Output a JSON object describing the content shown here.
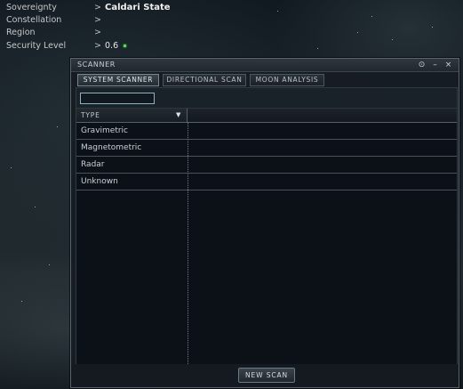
{
  "info": {
    "rows": [
      {
        "label": "Sovereignty",
        "arrow": ">",
        "value": "Caldari State"
      },
      {
        "label": "Constellation",
        "arrow": ">",
        "value": ""
      },
      {
        "label": "Region",
        "arrow": ">",
        "value": ""
      },
      {
        "label": "Security Level",
        "arrow": ">",
        "value": "0.6"
      }
    ],
    "security_color": "#4ddf4d"
  },
  "window": {
    "title": "SCANNER",
    "buttons": {
      "options": "⊙",
      "minimize": "–",
      "close": "×"
    },
    "tabs": [
      {
        "label": "SYSTEM SCANNER",
        "active": true
      },
      {
        "label": "DIRECTIONAL SCAN",
        "active": false
      },
      {
        "label": "MOON ANALYSIS",
        "active": false
      }
    ],
    "filter": {
      "value": "",
      "placeholder": ""
    },
    "columns": {
      "type": "TYPE",
      "sort_icon": "▼"
    },
    "rows": [
      "Gravimetric",
      "Magnetometric",
      "Radar",
      "Unknown"
    ],
    "new_scan_label": "NEW SCAN"
  }
}
